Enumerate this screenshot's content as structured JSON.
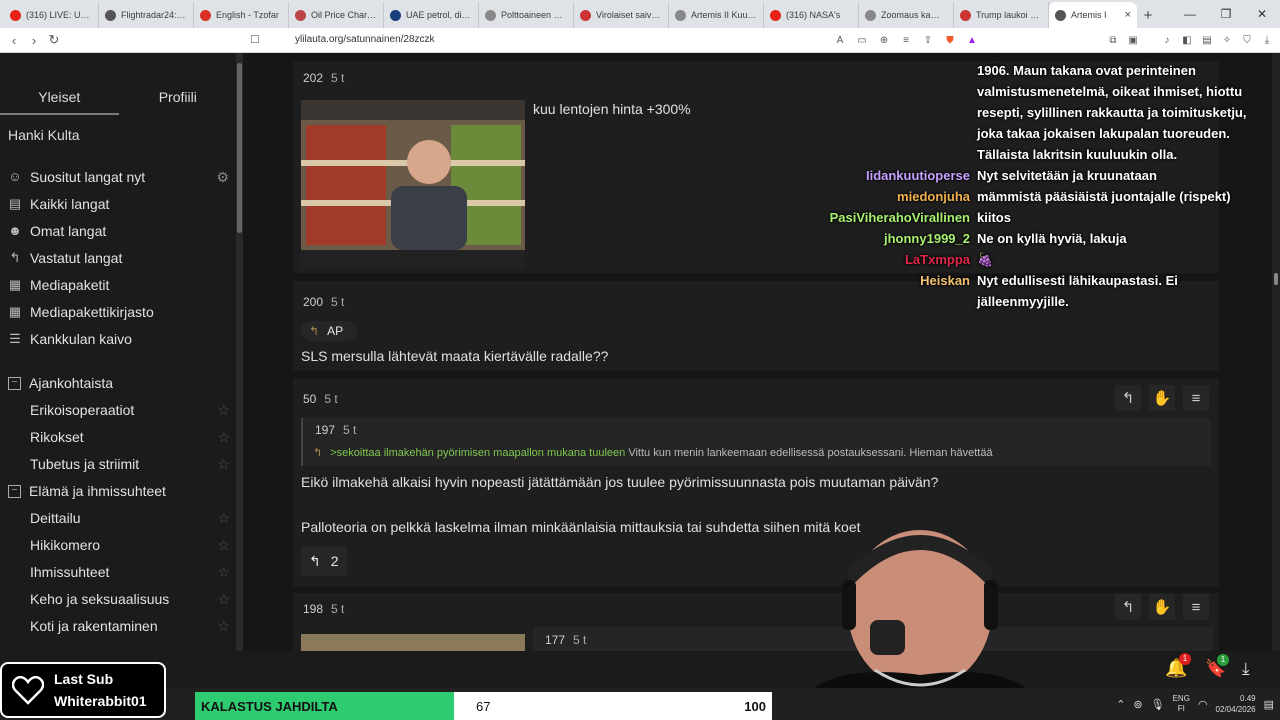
{
  "browser": {
    "tabs": [
      {
        "title": "(316) LIVE: Ukrai",
        "color": "#e62117"
      },
      {
        "title": "Flightradar24: Liv",
        "color": "#555"
      },
      {
        "title": "English - Tzofar",
        "color": "#d93025"
      },
      {
        "title": "Oil Price Charts |",
        "color": "#b44"
      },
      {
        "title": "UAE petrol, diese",
        "color": "#1a3d7c"
      },
      {
        "title": "Polttoaineen hinn",
        "color": "#888"
      },
      {
        "title": "Virolaiset saivat p",
        "color": "#c33"
      },
      {
        "title": "Artemis II Kuun h",
        "color": "#888"
      },
      {
        "title": "(316) NASA's",
        "color": "#e62117"
      },
      {
        "title": "Zoomaus kamera",
        "color": "#888"
      },
      {
        "title": "Trump laukoi Sur",
        "color": "#c33"
      }
    ],
    "active_tab": {
      "title": "Artemis I",
      "close": "×"
    },
    "new_tab": "+",
    "url": "ylilauta.org/satunnainen/28zczk"
  },
  "sidebar": {
    "tabs": [
      "Yleiset",
      "Profiili"
    ],
    "header": "Hanki Kulta",
    "items": [
      {
        "label": "Suositut langat nyt",
        "icon": "flame-icon"
      },
      {
        "label": "Kaikki langat",
        "icon": "list-icon"
      },
      {
        "label": "Omat langat",
        "icon": "user-icon"
      },
      {
        "label": "Vastatut langat",
        "icon": "reply-icon"
      },
      {
        "label": "Mediapaketit",
        "icon": "media-icon"
      },
      {
        "label": "Mediapakettikirjasto",
        "icon": "library-icon"
      },
      {
        "label": "Kankkulan kaivo",
        "icon": "well-icon"
      }
    ],
    "categories": [
      {
        "label": "Ajankohtaista",
        "subs": [
          "Erikoisoperaatiot",
          "Rikokset",
          "Tubetus ja striimit"
        ]
      },
      {
        "label": "Elämä ja ihmissuhteet",
        "subs": [
          "Deittailu",
          "Hikikomero",
          "Ihmissuhteet",
          "Keho ja seksuaalisuus",
          "Koti ja rakentaminen"
        ]
      }
    ]
  },
  "posts": [
    {
      "id": "202",
      "time": "5 t",
      "text": "kuu lentojen hinta +300%"
    },
    {
      "id": "200",
      "time": "5 t",
      "reply_tag": "AP",
      "text": "SLS mersulla lähtevät maata kiertävälle radalle??"
    },
    {
      "id": "50",
      "time": "5 t",
      "quote": {
        "id": "197",
        "time": "5 t",
        "greentext": ">sekoittaa ilmakehän pyörimisen maapallon mukana tuuleen",
        "text": "Vittu kun menin lankeemaan edellisessä postauksessani. Hieman hävettää"
      },
      "text1": "Eikö ilmakehä alkaisi hyvin nopeasti jätättämään jos tuulee pyörimissuunnasta pois muutaman päivän?",
      "text2": "Palloteoria on pelkkä laskelma ilman minkäänlaisia mittauksia tai suhdetta siihen mitä koet",
      "reply_count": "2"
    },
    {
      "id": "198",
      "time": "5 t",
      "quote_id": "177",
      "quote_time": "5 t"
    }
  ],
  "chat": [
    {
      "user": "",
      "text": "1906. Maun takana ovat perinteinen valmistusmenetelmä, oikeat ihmiset, hiottu resepti, sylillinen rakkautta ja toimitusketju, joka takaa jokaisen lakupalan tuoreuden. Tällaista lakritsin kuuluukin olla.",
      "color": "#fff"
    },
    {
      "user": "Iidankuutioperse",
      "text": "Nyt selvitetään ja kruunataan",
      "color": "#c9a0ff"
    },
    {
      "user": "miedonjuha",
      "text": "mämmistä pääsiäistä juontajalle (rispekt)",
      "color": "#f0b050"
    },
    {
      "user": "PasiViherahoVirallinen",
      "text": "kiitos",
      "color": "#a8f070"
    },
    {
      "user": "jhonny1999_2",
      "text": "Ne on kyllä hyviä, lakuja",
      "color": "#a8f070"
    },
    {
      "user": "LaTxmppa",
      "text": "🍇",
      "color": "#e0284a"
    },
    {
      "user": "Heiskan",
      "text": "Nyt edullisesti lähikaupastasi. Ei jälleenmyyjille.",
      "color": "#f5c070"
    }
  ],
  "overlay": {
    "last_sub_label": "Last Sub",
    "last_sub_user": "Whiterabbit01",
    "goal_title": "KALASTUS JAHDILTA",
    "goal_current": "67",
    "goal_target": "100",
    "goal_progress": 0.67,
    "notif_count": "1",
    "bookmark_count": "1"
  },
  "tray": {
    "lang1": "ENG",
    "lang2": "FI",
    "time": "0.49",
    "date": "02/04/2026"
  }
}
